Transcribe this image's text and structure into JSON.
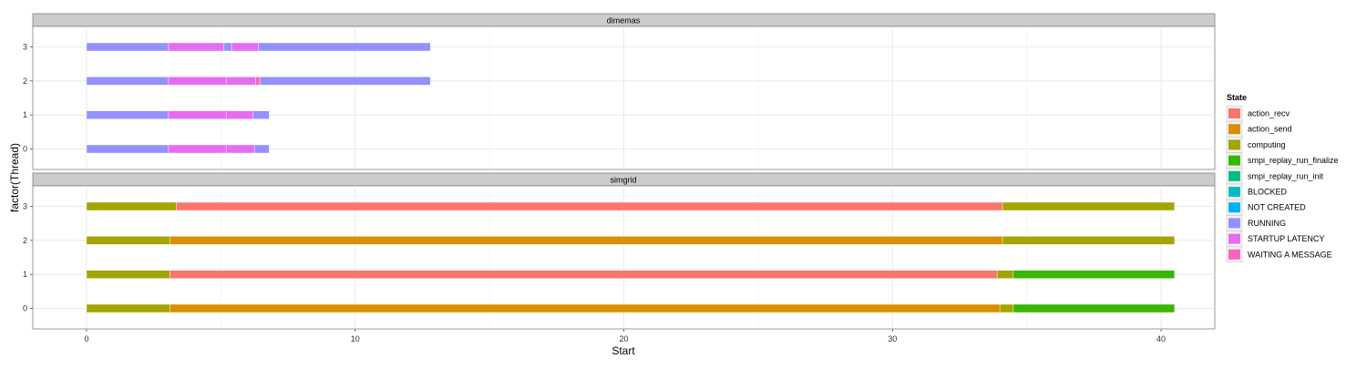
{
  "chart_data": {
    "type": "gantt",
    "xlabel": "Start",
    "ylabel": "factor(Thread)",
    "xlim": [
      -2,
      42
    ],
    "x_ticks": [
      0,
      10,
      20,
      30,
      40
    ],
    "y_categories": [
      "0",
      "1",
      "2",
      "3"
    ],
    "grid": true,
    "legend": {
      "title": "State",
      "position": "right",
      "entries": [
        {
          "name": "action_recv",
          "color": "#F8766D"
        },
        {
          "name": "action_send",
          "color": "#D89000"
        },
        {
          "name": "computing",
          "color": "#A3A500"
        },
        {
          "name": "smpi_replay_run_finalize",
          "color": "#39B600"
        },
        {
          "name": "smpi_replay_run_init",
          "color": "#00BF7D"
        },
        {
          "name": "BLOCKED",
          "color": "#00BFC4"
        },
        {
          "name": "NOT CREATED",
          "color": "#00B0F6"
        },
        {
          "name": "RUNNING",
          "color": "#9590FF"
        },
        {
          "name": "STARTUP LATENCY",
          "color": "#E76BF3"
        },
        {
          "name": "WAITING A MESSAGE",
          "color": "#FF62BC"
        }
      ]
    },
    "panels": [
      {
        "label": "dimemas",
        "threads": [
          {
            "thread": "3",
            "segments": [
              {
                "state": "RUNNING",
                "start": 0.0,
                "end": 3.05
              },
              {
                "state": "STARTUP LATENCY",
                "start": 3.05,
                "end": 5.1
              },
              {
                "state": "RUNNING",
                "start": 5.1,
                "end": 5.4
              },
              {
                "state": "STARTUP LATENCY",
                "start": 5.4,
                "end": 6.4
              },
              {
                "state": "RUNNING",
                "start": 6.4,
                "end": 12.8
              }
            ]
          },
          {
            "thread": "2",
            "segments": [
              {
                "state": "RUNNING",
                "start": 0.0,
                "end": 3.05
              },
              {
                "state": "STARTUP LATENCY",
                "start": 3.05,
                "end": 5.2
              },
              {
                "state": "STARTUP LATENCY",
                "start": 5.2,
                "end": 6.3
              },
              {
                "state": "WAITING A MESSAGE",
                "start": 6.3,
                "end": 6.45
              },
              {
                "state": "RUNNING",
                "start": 6.45,
                "end": 12.8
              }
            ]
          },
          {
            "thread": "1",
            "segments": [
              {
                "state": "RUNNING",
                "start": 0.0,
                "end": 3.05
              },
              {
                "state": "STARTUP LATENCY",
                "start": 3.05,
                "end": 5.2
              },
              {
                "state": "STARTUP LATENCY",
                "start": 5.2,
                "end": 6.2
              },
              {
                "state": "RUNNING",
                "start": 6.2,
                "end": 6.8
              }
            ]
          },
          {
            "thread": "0",
            "segments": [
              {
                "state": "RUNNING",
                "start": 0.0,
                "end": 3.05
              },
              {
                "state": "STARTUP LATENCY",
                "start": 3.05,
                "end": 5.2
              },
              {
                "state": "STARTUP LATENCY",
                "start": 5.2,
                "end": 6.25
              },
              {
                "state": "RUNNING",
                "start": 6.25,
                "end": 6.8
              }
            ]
          }
        ]
      },
      {
        "label": "simgrid",
        "threads": [
          {
            "thread": "3",
            "segments": [
              {
                "state": "computing",
                "start": 0.0,
                "end": 3.35
              },
              {
                "state": "action_recv",
                "start": 3.35,
                "end": 34.1
              },
              {
                "state": "computing",
                "start": 34.1,
                "end": 40.5
              }
            ]
          },
          {
            "thread": "2",
            "segments": [
              {
                "state": "computing",
                "start": 0.0,
                "end": 3.1
              },
              {
                "state": "action_send",
                "start": 3.1,
                "end": 34.1
              },
              {
                "state": "computing",
                "start": 34.1,
                "end": 40.5
              }
            ]
          },
          {
            "thread": "1",
            "segments": [
              {
                "state": "computing",
                "start": 0.0,
                "end": 3.1
              },
              {
                "state": "action_recv",
                "start": 3.1,
                "end": 33.9
              },
              {
                "state": "computing",
                "start": 33.9,
                "end": 34.5
              },
              {
                "state": "smpi_replay_run_finalize",
                "start": 34.5,
                "end": 40.5
              }
            ]
          },
          {
            "thread": "0",
            "segments": [
              {
                "state": "computing",
                "start": 0.0,
                "end": 3.1
              },
              {
                "state": "action_send",
                "start": 3.1,
                "end": 34.0
              },
              {
                "state": "computing",
                "start": 34.0,
                "end": 34.5
              },
              {
                "state": "smpi_replay_run_finalize",
                "start": 34.5,
                "end": 40.5
              }
            ]
          }
        ]
      }
    ]
  }
}
